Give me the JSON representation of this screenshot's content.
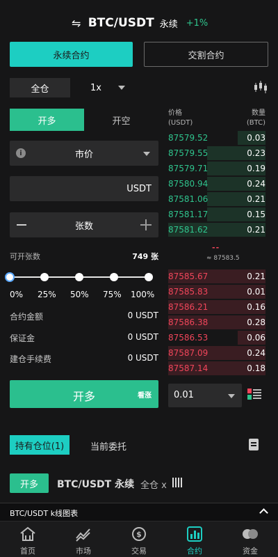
{
  "header": {
    "pair": "BTC/USDT",
    "contract_type": "永续",
    "change": "+1%"
  },
  "contract_tabs": [
    {
      "label": "永续合约",
      "active": true
    },
    {
      "label": "交割合约",
      "active": false
    }
  ],
  "margin_mode": "全仓",
  "leverage": "1x",
  "side_tabs": [
    {
      "label": "开多",
      "active": true
    },
    {
      "label": "开空",
      "active": false
    }
  ],
  "order_type": "市价",
  "price_input": {
    "unit": "USDT",
    "value": ""
  },
  "amount_input": {
    "placeholder": "张数"
  },
  "available": {
    "label": "可开张数",
    "value": "749 张"
  },
  "slider": {
    "labels": [
      "0%",
      "25%",
      "50%",
      "75%",
      "100%"
    ],
    "value_percent": 0
  },
  "summary": [
    {
      "label": "合约金额",
      "value": "0 USDT"
    },
    {
      "label": "保证金",
      "value": "0 USDT"
    },
    {
      "label": "建仓手续费",
      "value": "0 USDT"
    }
  ],
  "submit": {
    "label": "开多",
    "sub_label": "看涨"
  },
  "orderbook": {
    "price_header": "价格",
    "price_unit": "(USDT)",
    "qty_header": "数量",
    "qty_unit": "(BTC)",
    "bids": [
      {
        "price": "87579.52",
        "qty": "0.03"
      },
      {
        "price": "87579.55",
        "qty": "0.23"
      },
      {
        "price": "87579.71",
        "qty": "0.19"
      },
      {
        "price": "87580.94",
        "qty": "0.24"
      },
      {
        "price": "87581.06",
        "qty": "0.21"
      },
      {
        "price": "87581.17",
        "qty": "0.15"
      },
      {
        "price": "87581.62",
        "qty": "0.21"
      }
    ],
    "last_price": "--",
    "mark_price": "≈ 87583.5",
    "asks": [
      {
        "price": "87585.67",
        "qty": "0.21"
      },
      {
        "price": "87585.83",
        "qty": "0.01"
      },
      {
        "price": "87586.21",
        "qty": "0.16"
      },
      {
        "price": "87586.38",
        "qty": "0.28"
      },
      {
        "price": "87586.53",
        "qty": "0.06"
      },
      {
        "price": "87587.09",
        "qty": "0.24"
      },
      {
        "price": "87587.14",
        "qty": "0.18"
      }
    ],
    "depth": "0.01"
  },
  "bottom_tabs": [
    {
      "label": "持有仓位(1)",
      "active": true
    },
    {
      "label": "当前委托",
      "active": false
    }
  ],
  "position": {
    "side": "开多",
    "pair": "BTC/USDT 永续",
    "mode": "全仓 x"
  },
  "chart_bar": {
    "label": "BTC/USDT k线图表"
  },
  "nav": [
    {
      "label": "首页",
      "icon": "home-icon",
      "active": false
    },
    {
      "label": "市场",
      "icon": "market-icon",
      "active": false
    },
    {
      "label": "交易",
      "icon": "trade-icon",
      "active": false
    },
    {
      "label": "合约",
      "icon": "contract-icon",
      "active": true
    },
    {
      "label": "资金",
      "icon": "assets-icon",
      "active": false
    }
  ],
  "colors": {
    "accent": "#1dcec2",
    "buy": "#2bbf8e",
    "bid_text": "#2fc48d",
    "ask_text": "#f0455a",
    "background": "#161617"
  }
}
